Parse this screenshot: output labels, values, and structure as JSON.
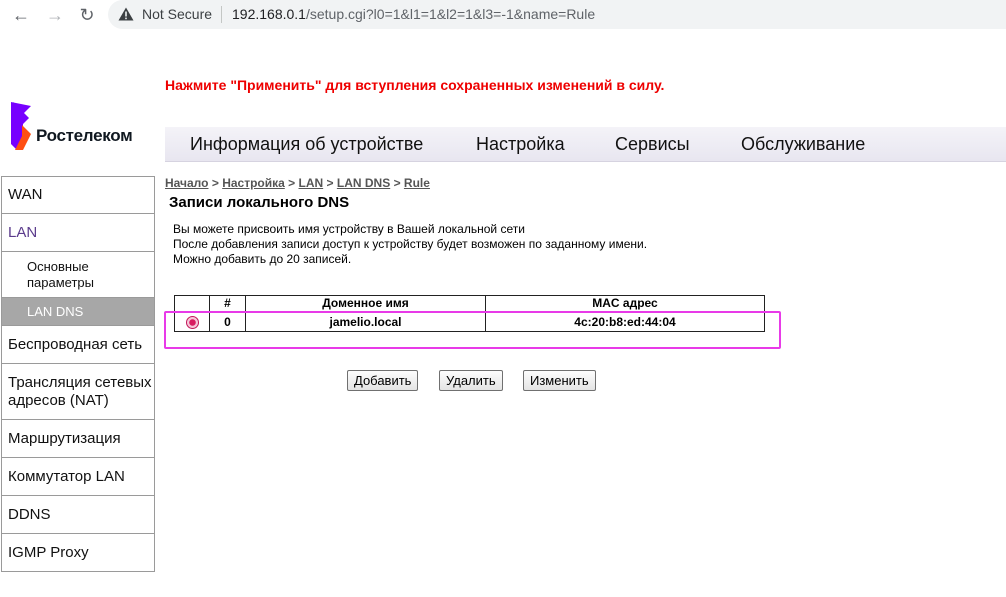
{
  "browser": {
    "security_label": "Not Secure",
    "url_host": "192.168.0.1",
    "url_path": "/setup.cgi?l0=1&l1=1&l2=1&l3=-1&name=Rule"
  },
  "notice": "Нажмите \"Применить\" для вступления сохраненных изменений в силу.",
  "brand": {
    "name": "Ростелеком",
    "colors": {
      "purple": "#7700ff",
      "orange": "#ff4f12"
    }
  },
  "topnav": [
    "Информация об устройстве",
    "Настройка",
    "Сервисы",
    "Обслуживание"
  ],
  "sidebar": {
    "items": [
      "WAN",
      "LAN",
      "Основные параметры",
      "LAN DNS",
      "Беспроводная сеть",
      "Трансляция сетевых адресов (NAT)",
      "Маршрутизация",
      "Коммутатор LAN",
      "DDNS",
      "IGMP Proxy"
    ]
  },
  "breadcrumb": [
    "Начало",
    "Настройка",
    "LAN",
    "LAN DNS",
    "Rule"
  ],
  "breadcrumb_separator": ">",
  "page_title": "Записи локального DNS",
  "description": [
    "Вы можете присвоить имя устройству в Вашей локальной сети",
    "После добавления записи доступ к устройству будет возможен по заданному имени.",
    "Можно добавить до 20 записей."
  ],
  "table": {
    "headers": [
      "",
      "#",
      "Доменное имя",
      "MAC адрес"
    ],
    "rows": [
      {
        "num": "0",
        "domain": "jamelio.local",
        "mac": "4c:20:b8:ed:44:04",
        "selected": true
      }
    ]
  },
  "buttons": {
    "add": "Добавить",
    "delete": "Удалить",
    "edit": "Изменить"
  }
}
